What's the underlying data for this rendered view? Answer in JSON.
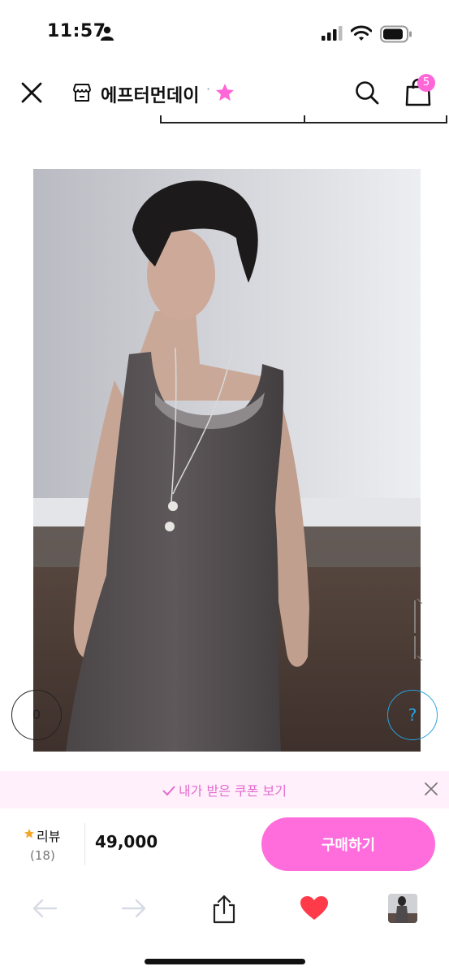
{
  "status_bar": {
    "time": "11:57"
  },
  "header": {
    "store_name": "에프터먼데이",
    "separator": "·",
    "cart_count": "5",
    "accent_color": "#ff66d8"
  },
  "gallery": {
    "prev_label": "0",
    "help_label": "?"
  },
  "coupon": {
    "text": "내가 받은 쿠폰 보기",
    "color": "#e36bd0"
  },
  "purchase": {
    "review_label": "리뷰",
    "review_count": "(18)",
    "price": "49,000",
    "buy_label": "구매하기",
    "buy_color": "#ff6ddc"
  },
  "icons": [
    "person-icon",
    "signal-icon",
    "wifi-icon",
    "battery-icon",
    "close-icon",
    "store-icon",
    "star-icon",
    "search-icon",
    "bag-icon",
    "back-arrow-icon",
    "forward-arrow-icon",
    "share-icon",
    "heart-icon"
  ]
}
